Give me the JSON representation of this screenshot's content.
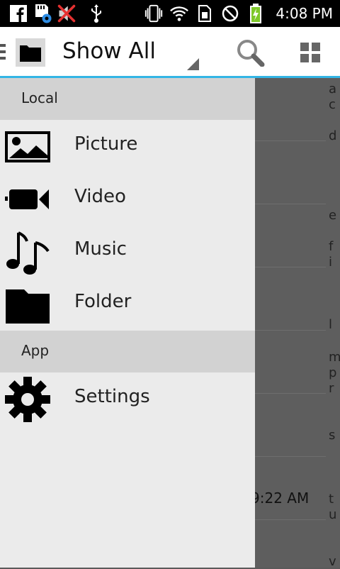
{
  "status_bar": {
    "time": "4:08 PM",
    "icons": [
      "facebook-icon",
      "sd-card-sync-icon",
      "muted-speaker-icon",
      "usb-icon",
      "vibrate-icon",
      "wifi-icon",
      "sim-icon",
      "no-signal-icon",
      "battery-charging-icon"
    ]
  },
  "action_bar": {
    "title": "Show All",
    "icons": [
      "drawer-indicator-icon",
      "folder-icon",
      "search-icon",
      "grid-view-icon"
    ]
  },
  "drawer": {
    "sections": [
      {
        "label": "Local",
        "items": [
          {
            "label": "Picture",
            "icon": "picture-icon"
          },
          {
            "label": "Video",
            "icon": "video-camera-icon"
          },
          {
            "label": "Music",
            "icon": "music-note-icon"
          },
          {
            "label": "Folder",
            "icon": "folder-icon"
          }
        ]
      },
      {
        "label": "App",
        "items": [
          {
            "label": "Settings",
            "icon": "gear-icon"
          }
        ]
      }
    ]
  },
  "background_list": {
    "visible_time": "9:22 AM",
    "index_letters": [
      "a",
      "c",
      "d",
      "e",
      "f",
      "i",
      "l",
      "m",
      "p",
      "r",
      "s",
      "t",
      "u",
      "v"
    ]
  },
  "colors": {
    "accent": "#33b5e5",
    "drawer_bg": "#ebebeb",
    "section_bg": "#d2d2d2",
    "status_bar": "#000000"
  }
}
